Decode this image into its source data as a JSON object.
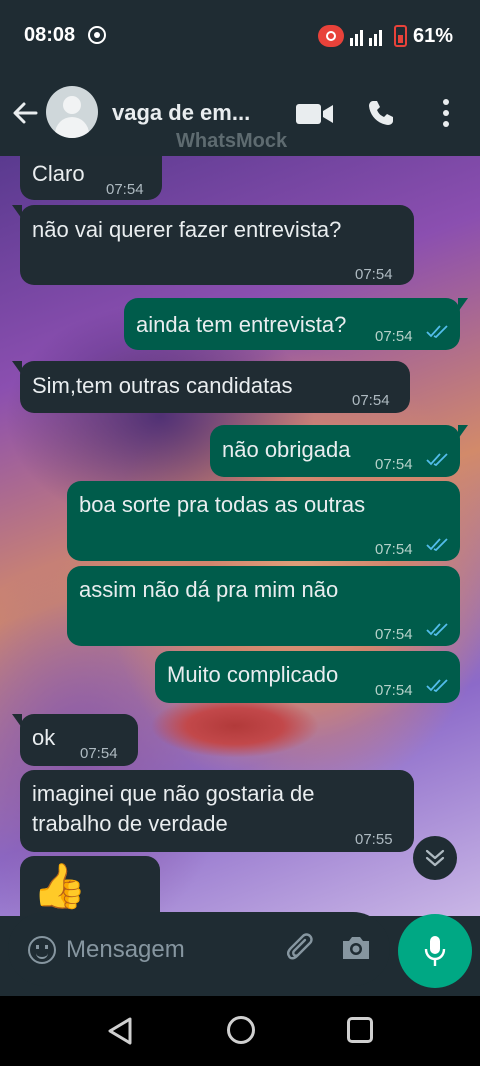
{
  "status_bar": {
    "time": "08:08",
    "battery_percent": "61%"
  },
  "header": {
    "contact_name": "vaga de em...",
    "watermark": "WhatsMock"
  },
  "messages": [
    {
      "direction": "in",
      "text": "Claro",
      "time": "07:54"
    },
    {
      "direction": "in",
      "text": "não vai querer fazer entrevista?",
      "time": "07:54"
    },
    {
      "direction": "out",
      "text": "ainda tem entrevista?",
      "time": "07:54",
      "status": "read"
    },
    {
      "direction": "in",
      "text": "Sim,tem outras candidatas",
      "time": "07:54"
    },
    {
      "direction": "out",
      "text": "não obrigada",
      "time": "07:54",
      "status": "read"
    },
    {
      "direction": "out",
      "text": "boa sorte pra todas as outras",
      "time": "07:54",
      "status": "read"
    },
    {
      "direction": "out",
      "text": "assim não dá pra mim não",
      "time": "07:54",
      "status": "read"
    },
    {
      "direction": "out",
      "text": "Muito complicado",
      "time": "07:54",
      "status": "read"
    },
    {
      "direction": "in",
      "text": "ok",
      "time": "07:54"
    },
    {
      "direction": "in",
      "text_line1": "imaginei que não gostaria de",
      "text_line2": "trabalho de verdade",
      "time": "07:55"
    },
    {
      "direction": "in",
      "emoji": "👍"
    }
  ],
  "composer": {
    "placeholder": "Mensagem"
  },
  "colors": {
    "header_bg": "#1f2c33",
    "incoming_bubble": "#202c33",
    "outgoing_bubble": "#005c4b",
    "read_ticks": "#53bdeb",
    "mic_button": "#00a884"
  },
  "icons": [
    "back-arrow-icon",
    "avatar-icon",
    "video-call-icon",
    "phone-icon",
    "more-vert-icon",
    "emoji-icon",
    "attach-icon",
    "camera-icon",
    "mic-icon",
    "scroll-down-icon",
    "read-ticks-icon"
  ]
}
